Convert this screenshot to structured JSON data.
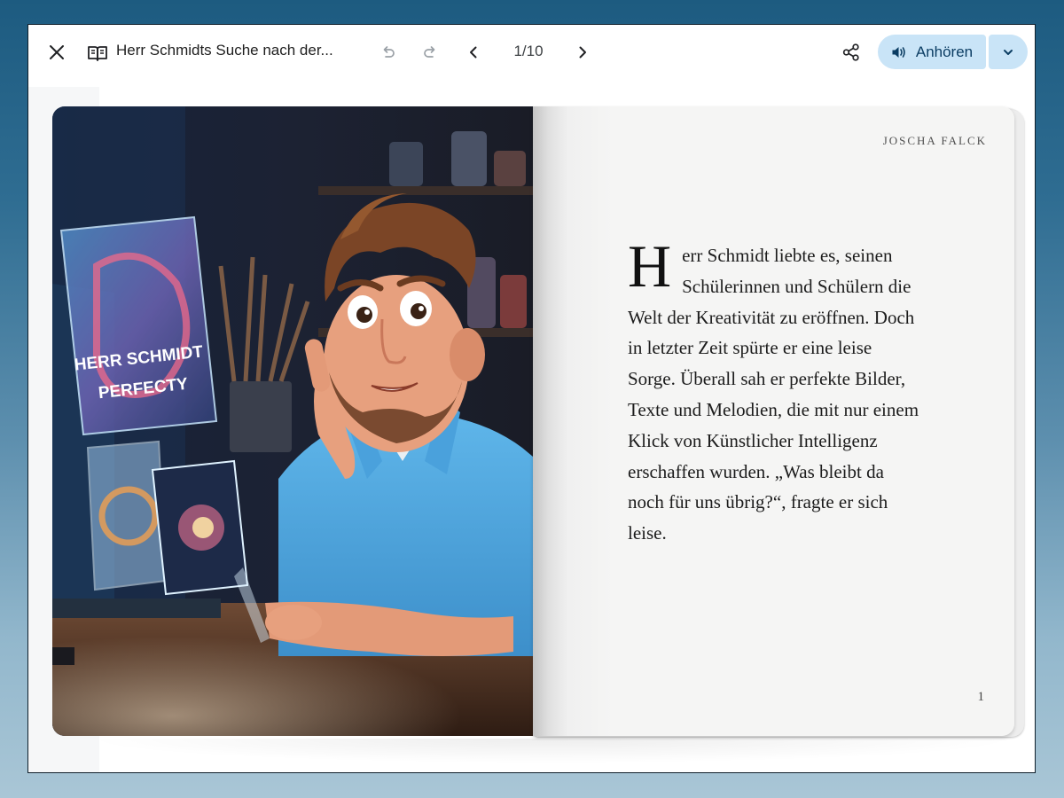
{
  "toolbar": {
    "title": "Herr Schmidts Suche nach der...",
    "page_indicator": "1/10",
    "listen_label": "Anhören"
  },
  "illustration": {
    "screen_text_line1": "HERR SCHMIDT",
    "screen_text_line2": "PERFECTY"
  },
  "page": {
    "author": "JOSCHA FALCK",
    "dropcap": "H",
    "body": "err Schmidt liebte es, seinen Schülerinnen und Schülern die Welt der Kreativität zu eröffnen. Doch in letzter Zeit spürte er eine leise Sorge. Überall sah er perfekte Bilder, Texte und Melodien, die mit nur einem Klick von Künstlicher Intelligenz erschaffen wurden. „Was bleibt da noch für uns übrig?“, fragte er sich leise.",
    "number": "1"
  },
  "icons": {
    "close": "close-icon",
    "book": "book-icon",
    "undo": "undo-icon",
    "redo": "redo-icon",
    "prev": "chevron-left-icon",
    "next": "chevron-right-icon",
    "share": "share-icon",
    "speaker": "speaker-icon",
    "dropdown": "chevron-down-icon"
  },
  "colors": {
    "listen_button_bg": "#c9e4f7",
    "listen_button_text": "#0b3d63"
  }
}
